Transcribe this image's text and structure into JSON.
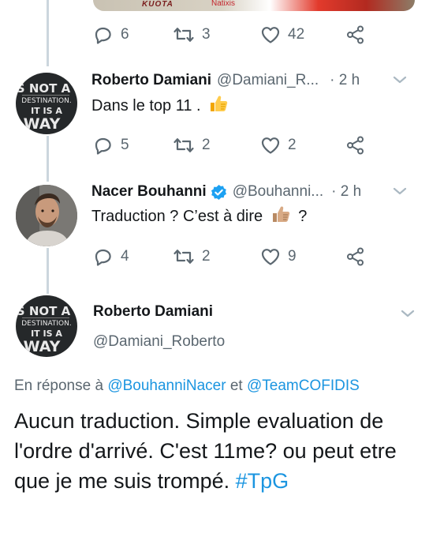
{
  "top_media": {
    "brand1": "KUOTA",
    "brand2": "Natixis"
  },
  "tweets": [
    {
      "stats": {
        "replies": "6",
        "retweets": "3",
        "likes": "42"
      }
    },
    {
      "author": {
        "name": "Roberto Damiani",
        "handle": "@Damiani_R...",
        "time": "· 2 h"
      },
      "avatar_text": {
        "l1": "S NOT A",
        "l2": "DESTINATION.",
        "l3": "IT IS A",
        "l4": "WAY"
      },
      "text": "Dans le top 11 .",
      "stats": {
        "replies": "5",
        "retweets": "2",
        "likes": "2"
      }
    },
    {
      "author": {
        "name": "Nacer Bouhanni",
        "verified": true,
        "handle": "@Bouhanni...",
        "time": "· 2 h"
      },
      "text_before": "Traduction ? C’est à dire",
      "text_after": "?",
      "stats": {
        "replies": "4",
        "retweets": "2",
        "likes": "9"
      }
    }
  ],
  "main_tweet": {
    "avatar_text": {
      "l1": "S NOT A",
      "l2": "DESTINATION.",
      "l3": "IT IS A",
      "l4": "WAY"
    },
    "name": "Roberto Damiani",
    "handle": "@Damiani_Roberto",
    "reply_prefix": "En réponse à",
    "reply_user1": "@BouhanniNacer",
    "reply_conj": "et",
    "reply_user2": "@TeamCOFIDIS",
    "text": "Aucun traduction. Simple evaluation de l'ordre d'arrivé. C'est 11me? ou peut etre que je me suis trompé.",
    "hashtag": "#TpG"
  },
  "colors": {
    "accent": "#1b95e0",
    "muted": "#5b6770",
    "line": "#ccd6dd",
    "verified": "#1da1f2"
  }
}
